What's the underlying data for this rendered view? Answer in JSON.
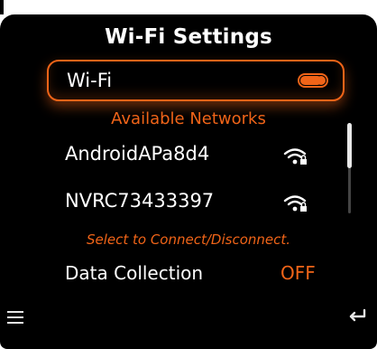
{
  "title": "Wi-Fi Settings",
  "wifi": {
    "label": "Wi-Fi",
    "enabled": true
  },
  "available_header": "Available Networks",
  "networks": [
    {
      "name": "AndroidAPa8d4",
      "icon": "wifi-lock-icon"
    },
    {
      "name": "NVRC73433397",
      "icon": "wifi-lock-icon"
    }
  ],
  "hint": "Select to Connect/Disconnect.",
  "data_collection": {
    "label": "Data Collection",
    "value": "OFF"
  },
  "colors": {
    "accent": "#f06418",
    "background": "#000000",
    "text": "#ffffff"
  },
  "icons": {
    "menu": "menu-icon",
    "back": "back-icon"
  }
}
